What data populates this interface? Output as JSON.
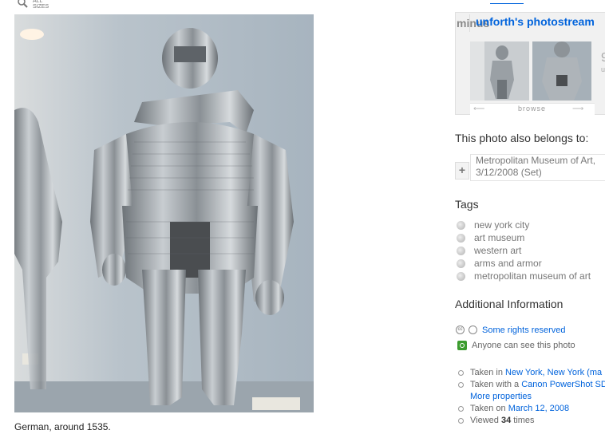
{
  "zoom": {
    "label": "All sizes",
    "icon": "magnifier-icon"
  },
  "photo": {
    "caption": "German, around 1535."
  },
  "photostream": {
    "collapse_icon": "minus",
    "title": "unforth's photostream",
    "browse_label": "browse",
    "count": "9",
    "count_sub": "u"
  },
  "sets": {
    "heading": "This photo also belongs to:",
    "add_icon": "+",
    "items": [
      {
        "name_line1": "Metropolitan Museum of Art,",
        "name_line2": "3/12/2008 (Set)"
      }
    ]
  },
  "tags": {
    "heading": "Tags",
    "items": [
      "new york city",
      "art museum",
      "western art",
      "arms and armor",
      "metropolitan museum of art"
    ]
  },
  "additional": {
    "heading": "Additional Information",
    "license_cc": "cc",
    "license_text": "Some rights reserved",
    "privacy_text": "Anyone can see this photo",
    "taken_in_prefix": "Taken in",
    "taken_in_link": "New York, New York",
    "taken_in_map": "(ma",
    "taken_with_prefix": "Taken with a",
    "taken_with_link": "Canon PowerShot SD",
    "more_properties": "More properties",
    "taken_on_prefix": "Taken on",
    "taken_on_link": "March 12, 2008",
    "viewed_prefix": "Viewed",
    "viewed_count": "34",
    "viewed_suffix": "times"
  }
}
